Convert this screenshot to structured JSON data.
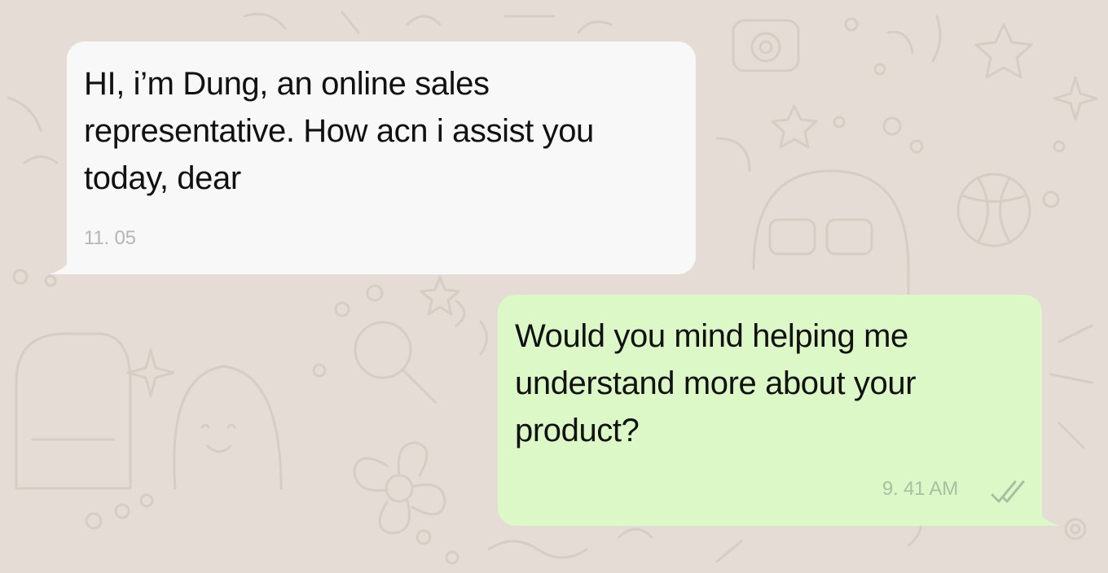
{
  "chat": {
    "messages": [
      {
        "direction": "incoming",
        "text": "HI, i’m Dung, an online sales representative. How acn i assist you today, dear",
        "time": "11. 05"
      },
      {
        "direction": "outgoing",
        "text": "Would you mind helping me understand more about your product?",
        "time": "9. 41 AM",
        "status_icon": "double-check-icon"
      }
    ]
  },
  "colors": {
    "background": "#e5ddd5",
    "doodle_stroke": "#d6cdc4",
    "incoming_bubble": "#f8f8f8",
    "outgoing_bubble": "#dcf8c6",
    "timestamp": "#b5b5b5",
    "ticks": "#a9bfa2"
  }
}
